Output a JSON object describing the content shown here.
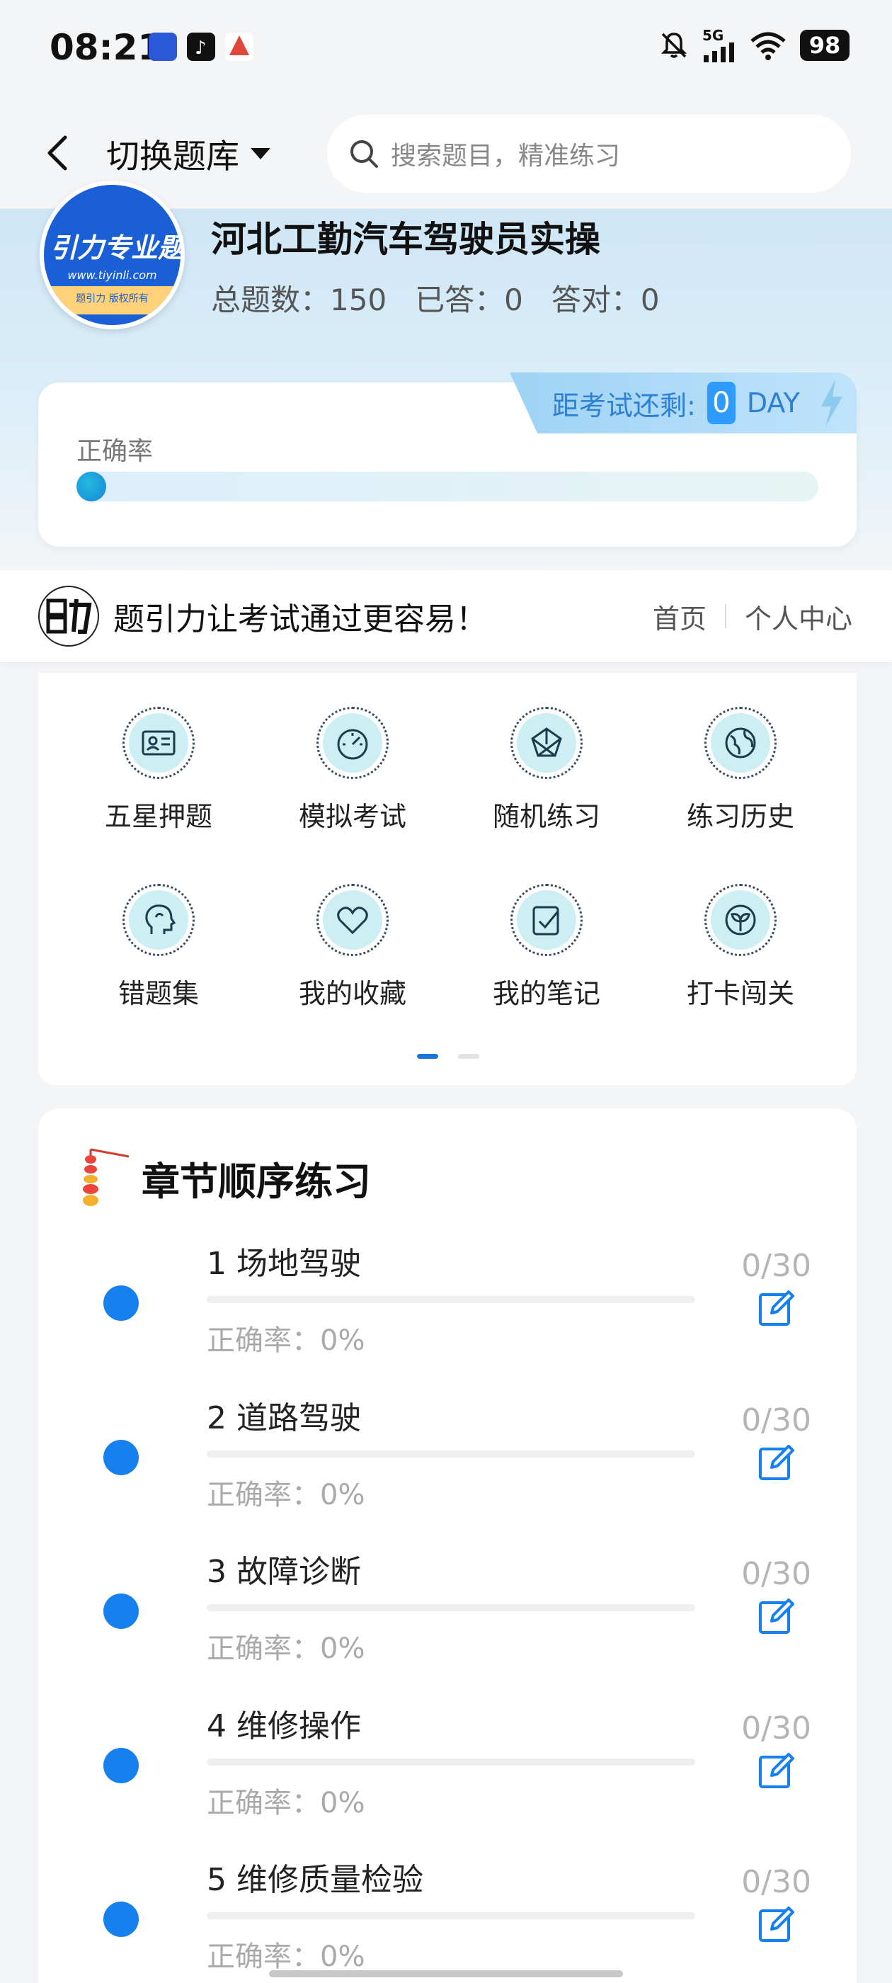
{
  "status": {
    "time": "08:21",
    "network": "5G",
    "battery": "98"
  },
  "header": {
    "switch_label": "切换题库",
    "search_placeholder": "搜索题目，精准练习"
  },
  "bank": {
    "logo_text": "引力专业题",
    "logo_url": "www.tiyinli.com",
    "logo_copyright": "题引力 版权所有",
    "title": "河北工勤汽车驾驶员实操",
    "total_label": "总题数：150",
    "answered_label": "已答：0",
    "correct_label": "答对：0"
  },
  "accuracy": {
    "label": "正确率",
    "value_percent": 0,
    "countdown_label": "距考试还剩:",
    "countdown_value": "0",
    "countdown_unit": "DAY"
  },
  "brand": {
    "logo_text": "题引力",
    "slogan": "题引力让考试通过更容易！",
    "links": [
      "首页",
      "个人中心"
    ]
  },
  "menu": [
    {
      "label": "五星押题",
      "icon": "id-card-icon"
    },
    {
      "label": "模拟考试",
      "icon": "speedometer-icon"
    },
    {
      "label": "随机练习",
      "icon": "network-icon"
    },
    {
      "label": "练习历史",
      "icon": "globe-icon"
    },
    {
      "label": "错题集",
      "icon": "head-icon"
    },
    {
      "label": "我的收藏",
      "icon": "heart-icon"
    },
    {
      "label": "我的笔记",
      "icon": "note-check-icon"
    },
    {
      "label": "打卡闯关",
      "icon": "sprout-icon"
    }
  ],
  "chapters": {
    "title": "章节顺序练习",
    "items": [
      {
        "name": "1 场地驾驶",
        "accuracy": "正确率：0%",
        "count": "0/30"
      },
      {
        "name": "2 道路驾驶",
        "accuracy": "正确率：0%",
        "count": "0/30"
      },
      {
        "name": "3 故障诊断",
        "accuracy": "正确率：0%",
        "count": "0/30"
      },
      {
        "name": "4 维修操作",
        "accuracy": "正确率：0%",
        "count": "0/30"
      },
      {
        "name": "5 维修质量检验",
        "accuracy": "正确率：0%",
        "count": "0/30"
      }
    ]
  },
  "colors": {
    "accent": "#1681ee",
    "countdown": "#2f7fd3"
  }
}
